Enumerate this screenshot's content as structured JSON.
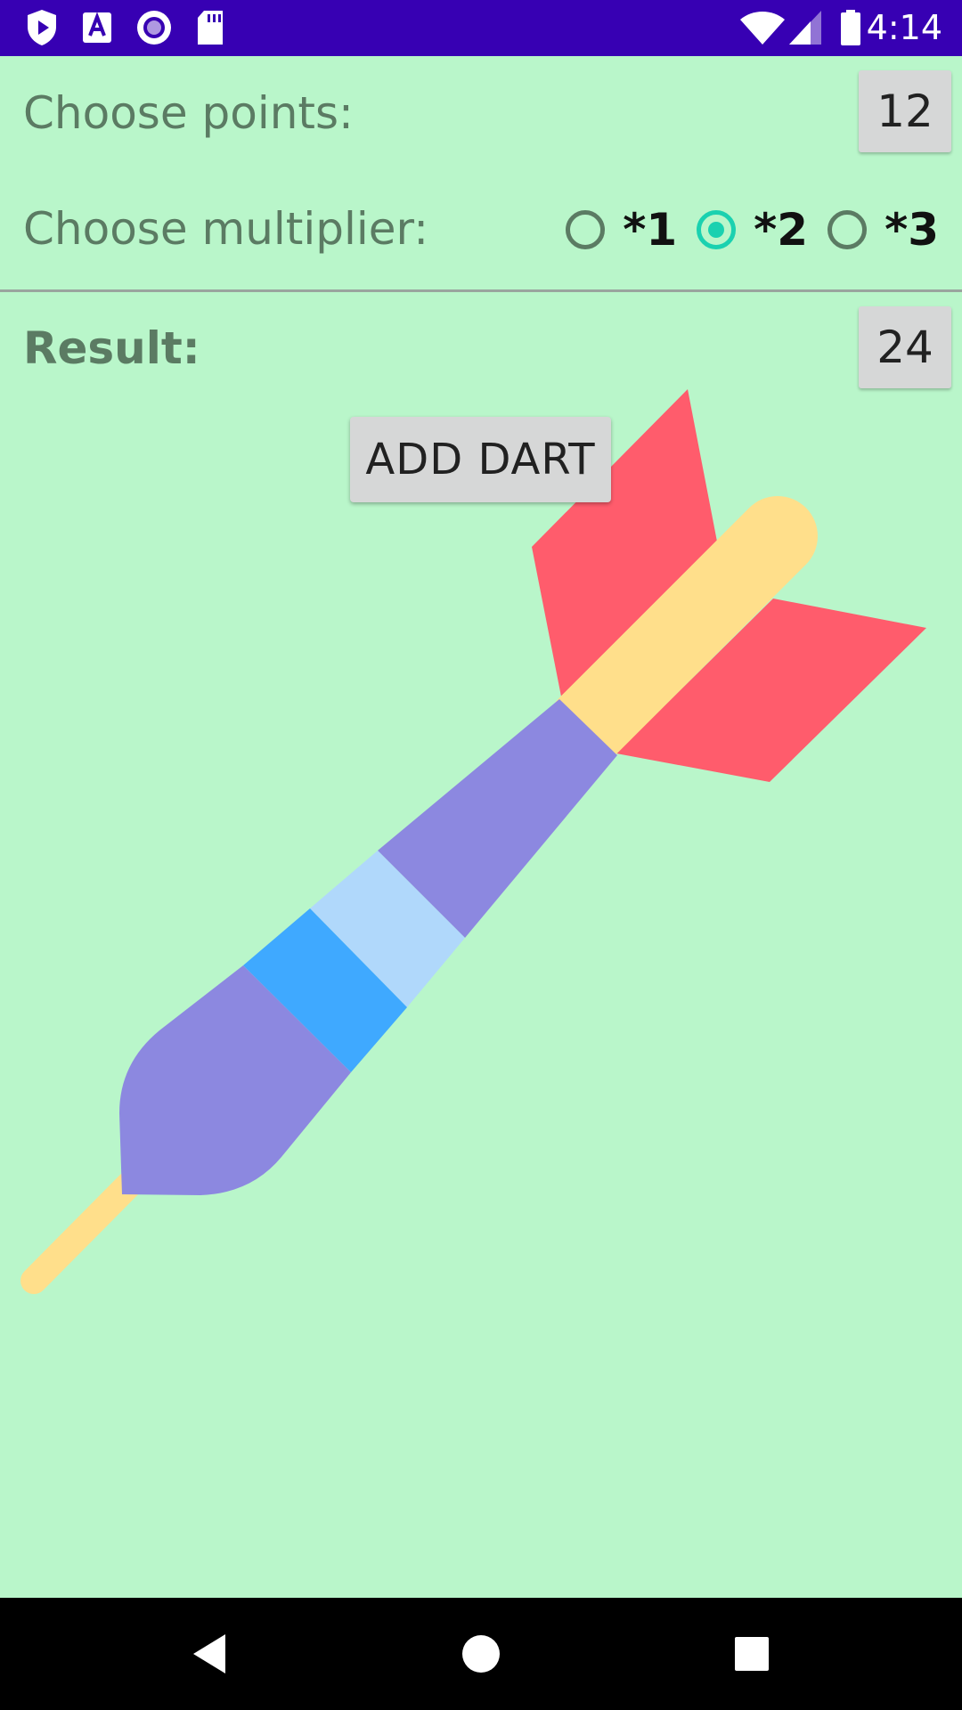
{
  "status_bar": {
    "time": "4:14",
    "left_icons": [
      "shield-play-icon",
      "font-a-icon",
      "circle-dot-icon",
      "sd-card-icon"
    ],
    "right_icons": [
      "wifi-icon",
      "signal-icon",
      "battery-icon"
    ],
    "background": "#3700b3"
  },
  "points": {
    "label": "Choose points:",
    "value": "12"
  },
  "multiplier": {
    "label": "Choose multiplier:",
    "options": [
      {
        "label": "*1",
        "checked": false
      },
      {
        "label": "*2",
        "checked": true
      },
      {
        "label": "*3",
        "checked": false
      }
    ]
  },
  "result": {
    "label": "Result:",
    "value": "24"
  },
  "button": {
    "label": "ADD DART"
  },
  "colors": {
    "background": "#b9f6ca",
    "radio_accent": "#1ad1b0",
    "dart_flight": "#ff5c6c",
    "dart_shaft": "#ffdf8b",
    "dart_barrel": "#8c88e0",
    "dart_ring_light": "#b0d8fb",
    "dart_ring_blue": "#3fa9ff"
  },
  "nav_bar": {
    "icons": [
      "back-icon",
      "home-icon",
      "recents-icon"
    ]
  }
}
